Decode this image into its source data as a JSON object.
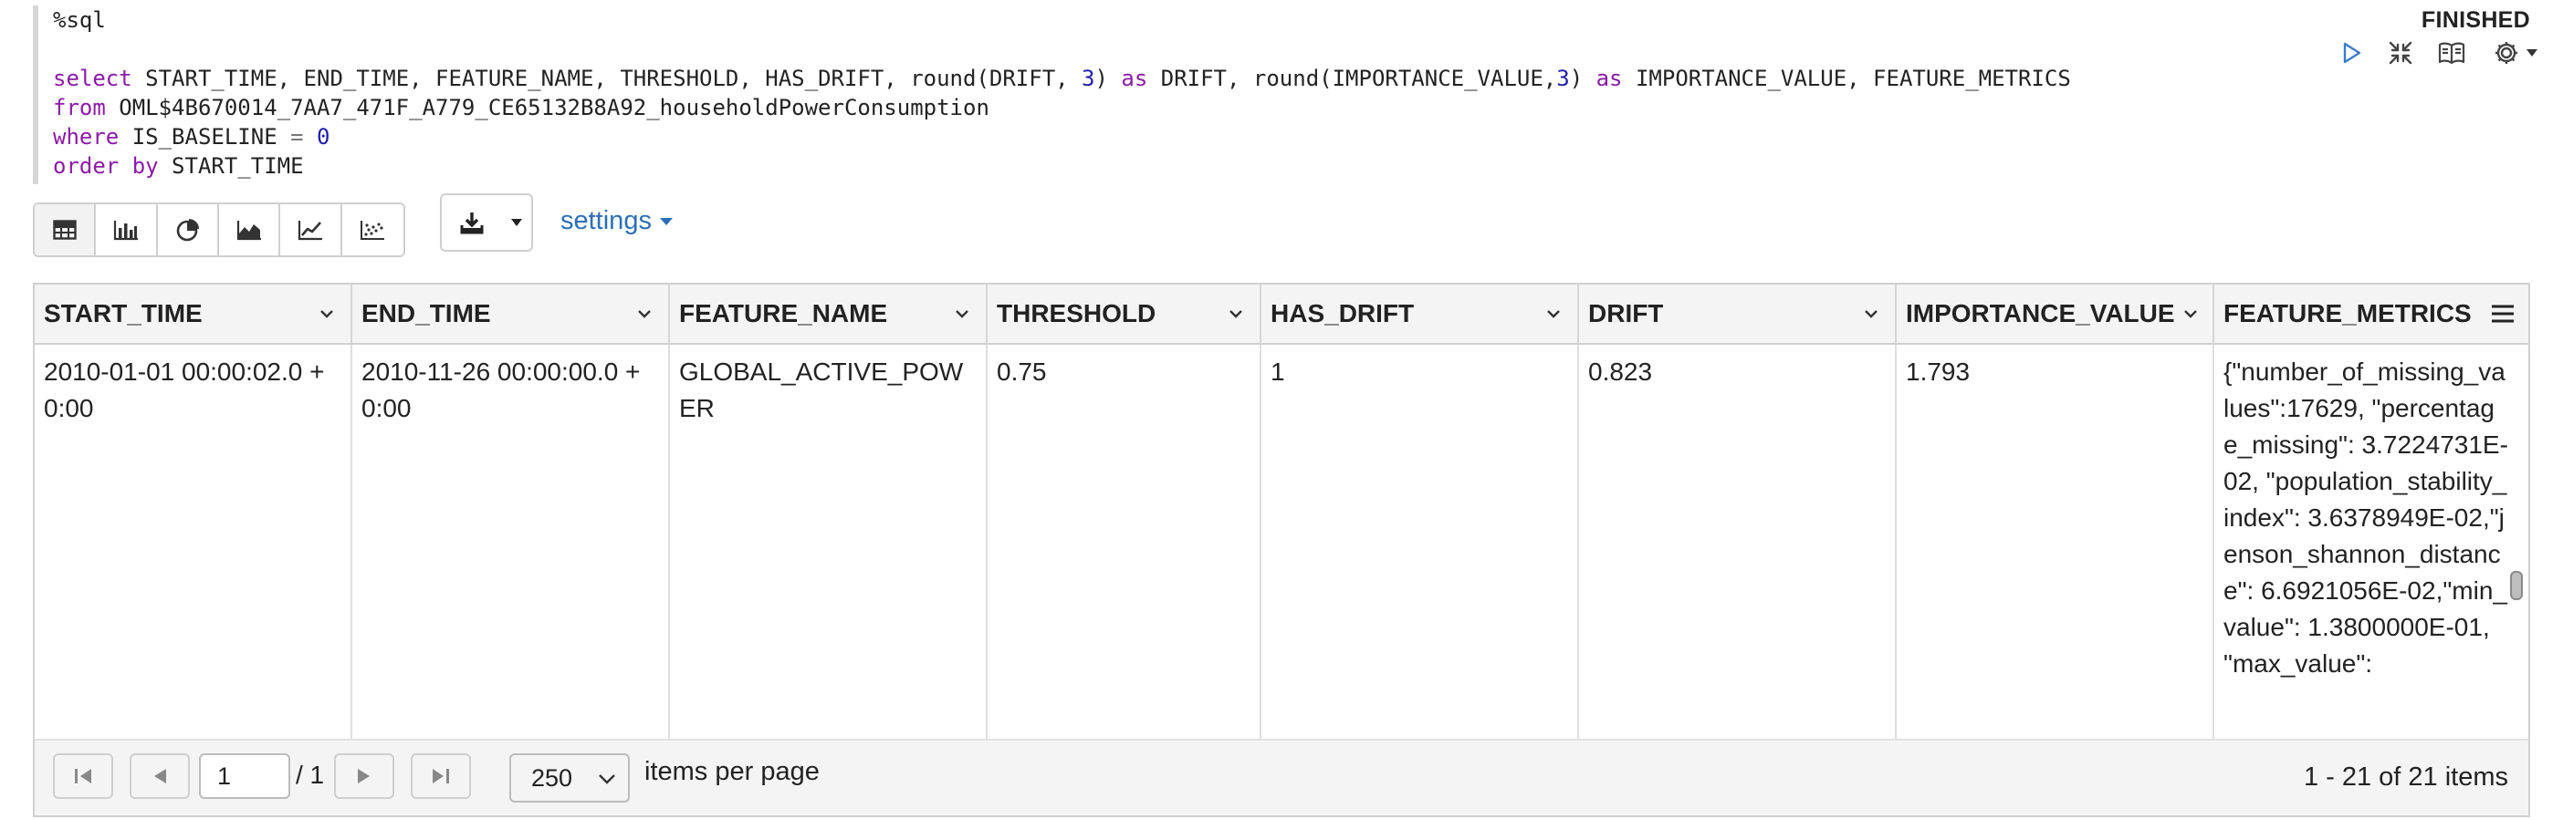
{
  "editor": {
    "lines": [
      {
        "parts": [
          {
            "t": "%sql",
            "c": "plain"
          }
        ]
      },
      {
        "parts": []
      },
      {
        "parts": [
          {
            "t": "select",
            "c": "kw"
          },
          {
            "t": " START_TIME, END_TIME, FEATURE_NAME, THRESHOLD, HAS_DRIFT, round(DRIFT, ",
            "c": "plain"
          },
          {
            "t": "3",
            "c": "num"
          },
          {
            "t": ") ",
            "c": "plain"
          },
          {
            "t": "as",
            "c": "kw"
          },
          {
            "t": " DRIFT, round(IMPORTANCE_VALUE,",
            "c": "plain"
          },
          {
            "t": "3",
            "c": "num"
          },
          {
            "t": ") ",
            "c": "plain"
          },
          {
            "t": "as",
            "c": "kw"
          },
          {
            "t": " IMPORTANCE_VALUE, FEATURE_METRICS",
            "c": "plain"
          }
        ]
      },
      {
        "parts": [
          {
            "t": "from",
            "c": "kw"
          },
          {
            "t": " OML$4B670014_7AA7_471F_A779_CE65132B8A92_householdPowerConsumption",
            "c": "plain"
          }
        ]
      },
      {
        "parts": [
          {
            "t": "where",
            "c": "kw"
          },
          {
            "t": " IS_BASELINE ",
            "c": "plain"
          },
          {
            "t": "=",
            "c": "op"
          },
          {
            "t": " ",
            "c": "plain"
          },
          {
            "t": "0",
            "c": "num"
          }
        ]
      },
      {
        "parts": [
          {
            "t": "order by",
            "c": "kw"
          },
          {
            "t": " START_TIME",
            "c": "plain"
          }
        ]
      }
    ]
  },
  "status": "FINISHED",
  "paragraph_controls": [
    "run-icon",
    "collapse-icon",
    "book-icon",
    "gear-icon"
  ],
  "toolbar": {
    "viz_buttons": [
      "table-icon",
      "bar-chart-icon",
      "pie-chart-icon",
      "area-chart-icon",
      "line-chart-icon",
      "scatter-chart-icon"
    ],
    "active_viz": "table-icon",
    "settings_label": "settings"
  },
  "grid": {
    "columns": [
      "START_TIME",
      "END_TIME",
      "FEATURE_NAME",
      "THRESHOLD",
      "HAS_DRIFT",
      "DRIFT",
      "IMPORTANCE_VALUE",
      "FEATURE_METRICS"
    ],
    "rows": [
      [
        "2010-01-01 00:00:02.0 +0:00",
        "2010-11-26 00:00:00.0 +0:00",
        "GLOBAL_ACTIVE_POWER",
        "0.75",
        "1",
        "0.823",
        "1.793",
        "{\"number_of_missing_values\":17629, \"percentage_missing\": 3.7224731E-02, \"population_stability_index\": 3.6378949E-02,\"jenson_shannon_distance\": 6.6921056E-02,\"min_value\": 1.3800000E-01, \"max_value\":"
      ]
    ]
  },
  "pager": {
    "current_page": "1",
    "total_pages": "/ 1",
    "page_size": "250",
    "items_per_page_label": "items per page",
    "range": "1 - 21 of 21 items"
  },
  "colors": {
    "keyword": "#8c1aa6",
    "number": "#1f1fa8",
    "link": "#2c6fb5",
    "header_bg": "#f4f4f4"
  }
}
